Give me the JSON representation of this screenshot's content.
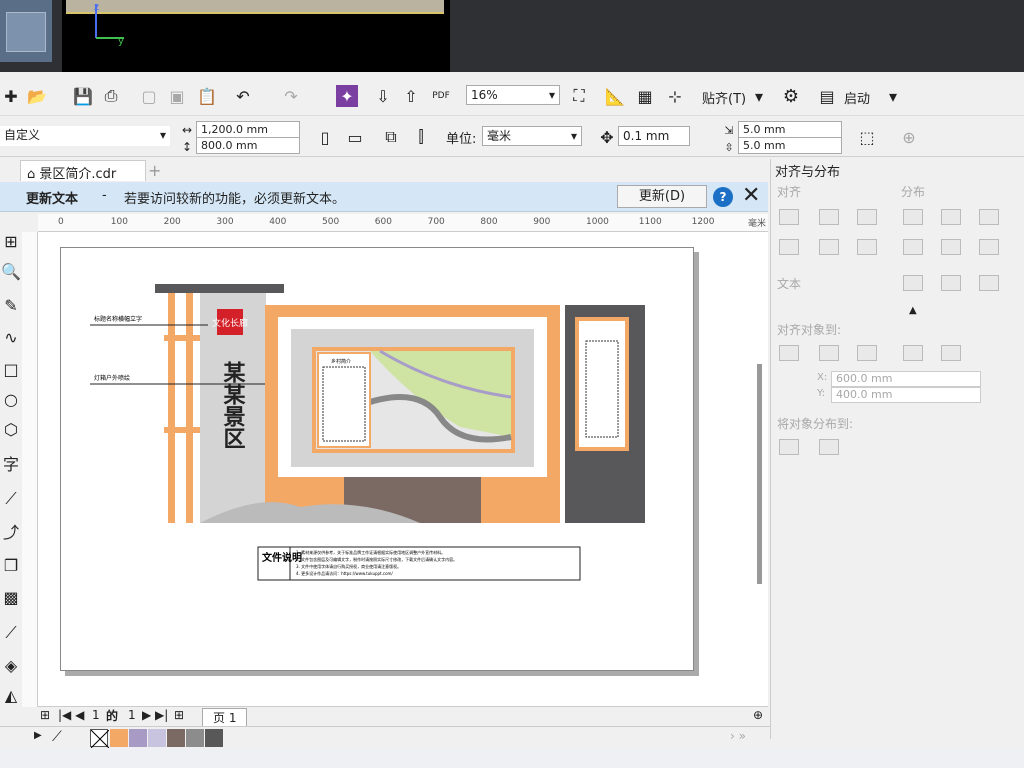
{
  "toolbar": {
    "zoom": "16%",
    "align_label": "贴齐(T)",
    "launch_label": "启动",
    "preset": "自定义",
    "width": "1,200.0 mm",
    "height": "800.0 mm",
    "unit_label": "单位:",
    "unit": "毫米",
    "nudge": "0.1 mm",
    "dup_x": "5.0 mm",
    "dup_y": "5.0 mm"
  },
  "tab": {
    "label": "景区简介.cdr"
  },
  "notice": {
    "title": "更新文本",
    "dash": "-",
    "message": "若要访问较新的功能，必须更新文本。",
    "button": "更新(D)"
  },
  "ruler": {
    "ticks": [
      "0",
      "100",
      "200",
      "300",
      "400",
      "500",
      "600",
      "700",
      "800",
      "900",
      "1000",
      "1100",
      "1200"
    ],
    "unit": "毫米"
  },
  "artwork": {
    "badge": "文化长廊",
    "main_title": "某某景区",
    "label1": "标题名称横幅立字",
    "label2": "灯箱户外喷绘",
    "board_title": "乡村简介",
    "notes_title": "文件说明",
    "notes": [
      "1. 素材来源仅供参考，关于标准品牌工作证请根据实际使用地区调整户外宣传材料。",
      "2. 文件包含图层及可编辑文字，制作时请按照实际尺寸修改，下载文件后请确认文字内容。",
      "3. 文件中使用字体请自行购买授权，商业使用请注意版权。",
      "4. 更多设计作品请访问：https://www.tukuppt.com/"
    ]
  },
  "pagenav": {
    "current": "1",
    "of": "的",
    "total": "1",
    "page_tab": "页 1"
  },
  "panel": {
    "title": "对齐与分布",
    "align": "对齐",
    "distribute": "分布",
    "text": "文本",
    "align_to": "对齐对象到:",
    "x": "600.0 mm",
    "y": "400.0 mm",
    "distribute_to": "将对象分布到:"
  },
  "palette": {
    "colors": [
      "#f3a865",
      "#a79bc5",
      "#c8c3de",
      "#7b6a63",
      "#8c8c8c",
      "#585858"
    ]
  },
  "colors": {
    "accent_orange": "#f3a865",
    "dark_gray": "#58585a",
    "notice_bg": "#d5e7f6"
  }
}
